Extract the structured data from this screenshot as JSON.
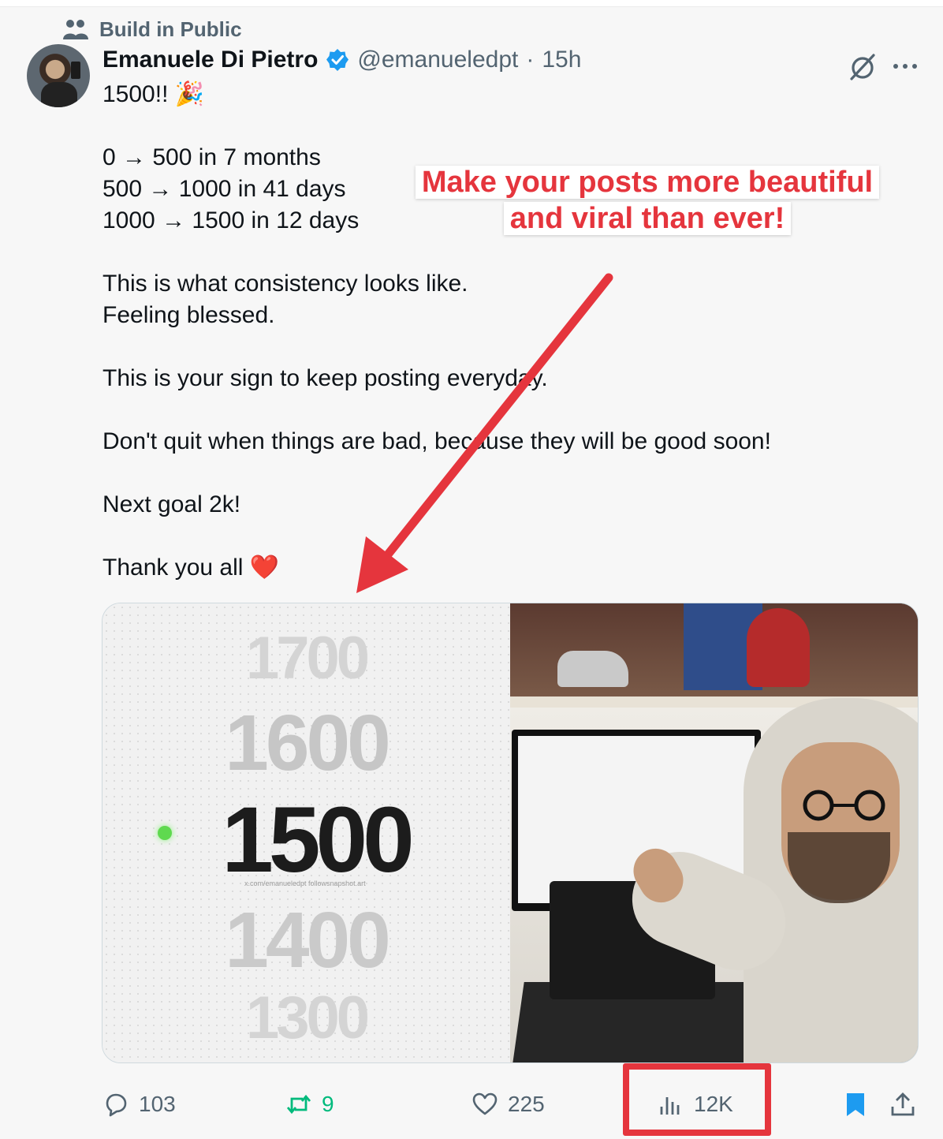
{
  "community": {
    "label": "Build in Public",
    "icon": "community-icon"
  },
  "author": {
    "display_name": "Emanuele Di Pietro",
    "handle": "@emanueledpt",
    "separator": "·",
    "time": "15h",
    "verified": true
  },
  "post": {
    "lines": [
      "1500!! 🎉",
      "",
      "0 → 500 in 7 months",
      "500 → 1000 in 41 days",
      "1000 → 1500 in 12 days",
      "",
      "This is what consistency looks like.",
      "Feeling blessed.",
      "",
      "This is your sign to keep posting everyday.",
      "",
      "Don't quit when things are bad, because they will be good soon!",
      "",
      "Next goal 2k!",
      "",
      "Thank you all ❤️"
    ]
  },
  "annotation": {
    "line1": "Make your posts more beautiful",
    "line2": "and viral than ever!",
    "color": "#e5353d"
  },
  "media": {
    "counter": {
      "values": [
        "1700",
        "1600",
        "1500",
        "1400",
        "1300"
      ],
      "watermark": "x.com/emanueledpt   followsnapshot.art"
    }
  },
  "actions": {
    "replies": "103",
    "reposts": "9",
    "likes": "225",
    "views": "12K"
  },
  "colors": {
    "accent": "#1d9bf0",
    "repost": "#00ba7c",
    "secondary_text": "#536471",
    "highlight": "#e5353d"
  }
}
